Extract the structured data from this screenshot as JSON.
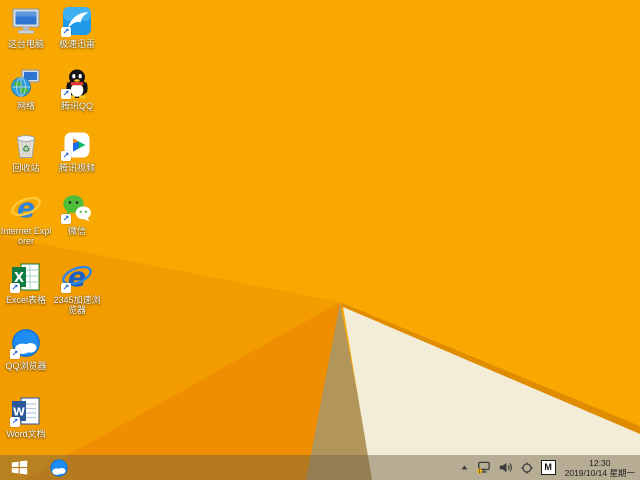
{
  "wallpaper": {
    "colors": {
      "base": "#F9A701",
      "shade": "#F29C00",
      "fold_dark": "#EE8E00",
      "fold_khaki": "#B2955A",
      "fold_cream": "#F3ECD6",
      "fold_edge": "#E08C00"
    }
  },
  "desktop": {
    "icons": [
      {
        "name": "this-pc",
        "label": "这台电脑"
      },
      {
        "name": "thunder",
        "label": "极速迅雷"
      },
      {
        "name": "network",
        "label": "网络"
      },
      {
        "name": "tencent-qq",
        "label": "腾讯QQ"
      },
      {
        "name": "recycle-bin",
        "label": "回收站"
      },
      {
        "name": "tencent-video",
        "label": "腾讯视频"
      },
      {
        "name": "internet-explorer",
        "label": "Internet Explorer",
        "glyph": "e"
      },
      {
        "name": "wechat",
        "label": "微信"
      },
      {
        "name": "excel",
        "label": "Excel表格",
        "glyph": "X"
      },
      {
        "name": "2345-browser",
        "label": "2345加速浏览器",
        "glyph": "e"
      },
      {
        "name": "qq-browser",
        "label": "QQ浏览器"
      },
      {
        "name": "word",
        "label": "Word文档",
        "glyph": "W"
      }
    ]
  },
  "taskbar": {
    "start_icon": "windows-logo",
    "pinned": [
      {
        "name": "qq-browser"
      }
    ],
    "tray": {
      "icons": [
        "hidden-icons-chevron",
        "network-warning",
        "volume",
        "float-utility",
        "ime-indicator",
        "clock"
      ],
      "ime_label": "M",
      "time": "12:30",
      "date": "2019/10/14 星期一"
    }
  }
}
